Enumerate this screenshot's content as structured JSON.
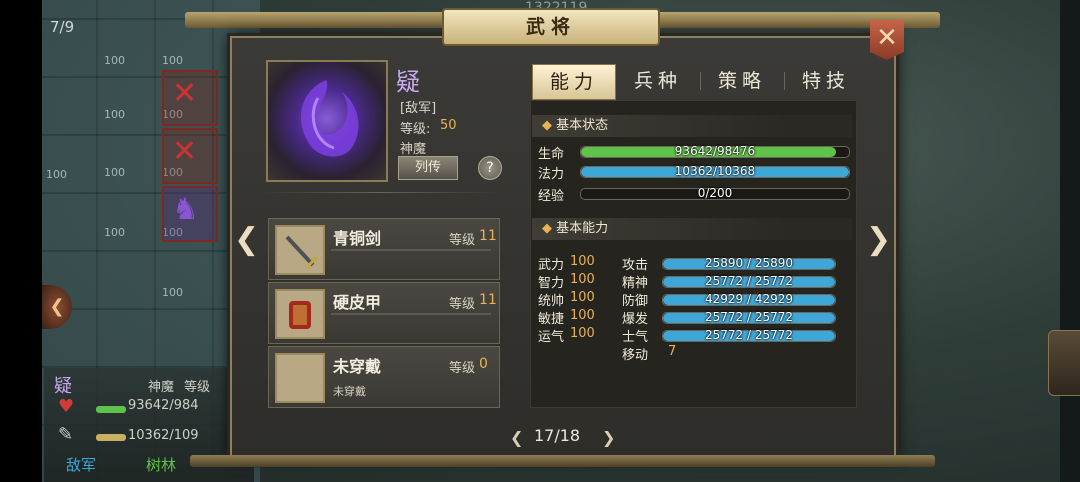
{
  "background": {
    "turn_counter": "7/9",
    "top_number": "1322119",
    "tile_labels": [
      "100",
      "100",
      "100",
      "100",
      "100",
      "100",
      "100",
      "100",
      "100",
      "100",
      "100",
      "100"
    ],
    "unit_panel": {
      "name": "疑",
      "type_label": "神魔",
      "level_label": "等级",
      "hp_text": "93642/984",
      "mp_text": "10362/109",
      "faction": "敌军",
      "terrain": "树林"
    }
  },
  "dialog": {
    "title": "武将",
    "close_icon": "close-x-icon",
    "hero": {
      "name": "疑",
      "faction": "[敌军]",
      "level_label": "等级:",
      "level": "50",
      "type": "神魔",
      "bio_button": "列传",
      "help_button": "?"
    },
    "equipment": [
      {
        "name": "青铜剑",
        "level_label": "等级",
        "level": "11",
        "sub": "",
        "icon": "bronze-sword-icon"
      },
      {
        "name": "硬皮甲",
        "level_label": "等级",
        "level": "11",
        "sub": "",
        "icon": "leather-armor-icon"
      },
      {
        "name": "未穿戴",
        "level_label": "等级",
        "level": "0",
        "sub": "未穿戴",
        "icon": "empty-slot-icon"
      }
    ],
    "tabs": [
      "能力",
      "兵种",
      "策略",
      "特技"
    ],
    "active_tab": 0,
    "basic_status": {
      "header": "基本状态",
      "rows": [
        {
          "label": "生命",
          "text": "93642/98476",
          "value": 93642,
          "max": 98476,
          "color": "#5fc24a"
        },
        {
          "label": "法力",
          "text": "10362/10368",
          "value": 10362,
          "max": 10368,
          "color": "#3fa6d8"
        },
        {
          "label": "经验",
          "text": "0/200",
          "value": 0,
          "max": 200,
          "color": "#c9b060"
        }
      ]
    },
    "basic_ability": {
      "header": "基本能力",
      "attributes": [
        {
          "label": "武力",
          "value": "100"
        },
        {
          "label": "智力",
          "value": "100"
        },
        {
          "label": "统帅",
          "value": "100"
        },
        {
          "label": "敏捷",
          "value": "100"
        },
        {
          "label": "运气",
          "value": "100"
        }
      ],
      "combat": [
        {
          "label": "攻击",
          "text": "25890 / 25890",
          "value": 25890,
          "max": 25890
        },
        {
          "label": "精神",
          "text": "25772 / 25772",
          "value": 25772,
          "max": 25772
        },
        {
          "label": "防御",
          "text": "42929 / 42929",
          "value": 42929,
          "max": 42929
        },
        {
          "label": "爆发",
          "text": "25772 / 25772",
          "value": 25772,
          "max": 25772
        },
        {
          "label": "士气",
          "text": "25772 / 25772",
          "value": 25772,
          "max": 25772
        }
      ],
      "move_label": "移动",
      "move_value": "7",
      "bar_color": "#3fa6d8"
    },
    "pager": {
      "text": "17/18"
    }
  }
}
